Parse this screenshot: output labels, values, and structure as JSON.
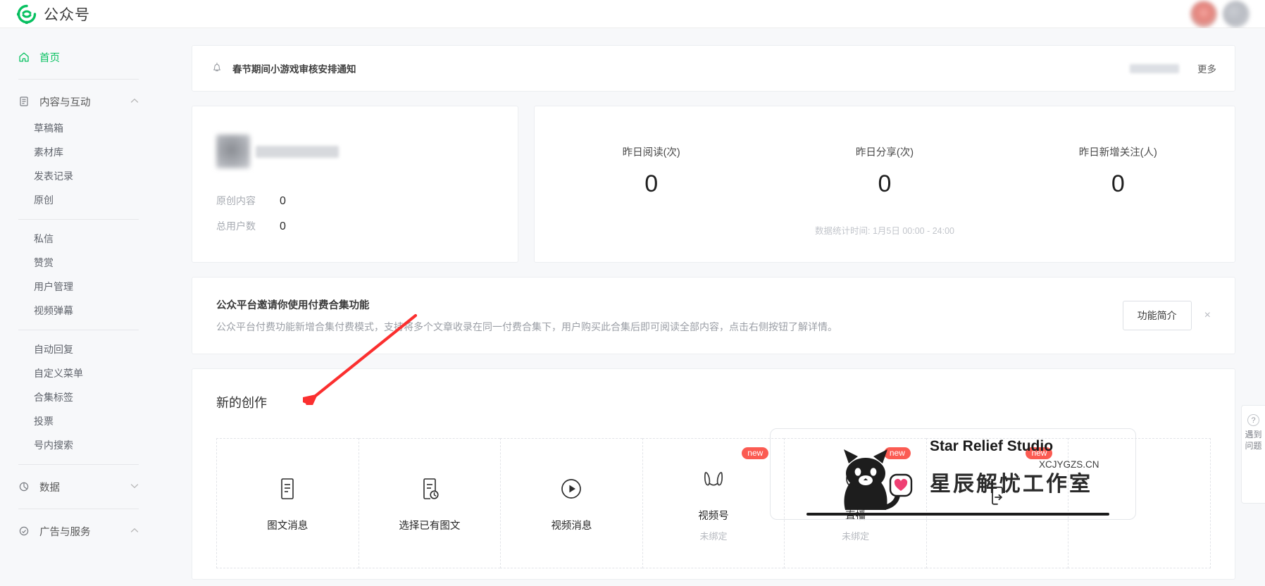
{
  "brand": {
    "title": "公众号",
    "logo_icon": "wechat-mp-logo-icon",
    "accent_color": "#07c160"
  },
  "topbar": {
    "notification_icon": "notification-avatar-icon",
    "user_avatar_icon": "user-avatar-icon"
  },
  "sidebar": {
    "home": {
      "label": "首页",
      "icon": "home-icon"
    },
    "groups": [
      {
        "label": "内容与互动",
        "icon": "content-icon",
        "chevron": "chevron-up-icon",
        "sections": [
          {
            "items": [
              {
                "label": "草稿箱"
              },
              {
                "label": "素材库"
              },
              {
                "label": "发表记录"
              },
              {
                "label": "原创"
              }
            ]
          },
          {
            "items": [
              {
                "label": "私信"
              },
              {
                "label": "赞赏"
              },
              {
                "label": "用户管理"
              },
              {
                "label": "视频弹幕"
              }
            ]
          },
          {
            "items": [
              {
                "label": "自动回复"
              },
              {
                "label": "自定义菜单"
              },
              {
                "label": "合集标签"
              },
              {
                "label": "投票"
              },
              {
                "label": "号内搜索"
              }
            ]
          }
        ]
      },
      {
        "label": "数据",
        "icon": "chart-pie-icon",
        "chevron": "chevron-down-icon",
        "sections": []
      },
      {
        "label": "广告与服务",
        "icon": "service-icon",
        "chevron": "chevron-up-icon",
        "sections": []
      }
    ]
  },
  "notice": {
    "icon": "bell-icon",
    "text": "春节期间小游戏审核安排通知",
    "more_label": "更多"
  },
  "account": {
    "avatar_icon": "account-avatar-icon",
    "name_masked": true,
    "metrics": [
      {
        "label": "原创内容",
        "value": "0"
      },
      {
        "label": "总用户数",
        "value": "0"
      }
    ]
  },
  "kpi": {
    "items": [
      {
        "title": "昨日阅读(次)",
        "value": "0"
      },
      {
        "title": "昨日分享(次)",
        "value": "0"
      },
      {
        "title": "昨日新增关注(人)",
        "value": "0"
      }
    ],
    "footnote": "数据统计时间: 1月5日 00:00 - 24:00"
  },
  "promo": {
    "title": "公众平台邀请你使用付费合集功能",
    "description": "公众平台付费功能新增合集付费模式，支持将多个文章收录在同一付费合集下，用户购买此合集后即可阅读全部内容，点击右侧按钮了解详情。",
    "button_label": "功能简介",
    "close_icon": "close-icon"
  },
  "create": {
    "title": "新的创作",
    "cards": [
      {
        "label": "图文消息",
        "sub": "",
        "icon": "article-icon",
        "badge": ""
      },
      {
        "label": "选择已有图文",
        "sub": "",
        "icon": "article-clock-icon",
        "badge": ""
      },
      {
        "label": "视频消息",
        "sub": "",
        "icon": "play-circle-icon",
        "badge": ""
      },
      {
        "label": "视频号",
        "sub": "未绑定",
        "icon": "channels-icon",
        "badge": "new"
      },
      {
        "label": "直播",
        "sub": "未绑定",
        "icon": "live-dot-icon",
        "badge": "new"
      },
      {
        "label": "",
        "sub": "",
        "icon": "share-icon",
        "badge": "new"
      },
      {
        "label": "",
        "sub": "",
        "icon": "",
        "badge": ""
      }
    ]
  },
  "help": {
    "icon": "question-circle-icon",
    "text": "遇到问题"
  },
  "watermark": {
    "brand_en": "Star Relief Studio",
    "url": "XCJYGZS.CN",
    "brand_cn": "星辰解忧工作室",
    "cat_icon": "cat-icon"
  },
  "annotation": {
    "arrow_color": "#fb2f2f",
    "arrow_icon": "red-arrow-icon"
  }
}
